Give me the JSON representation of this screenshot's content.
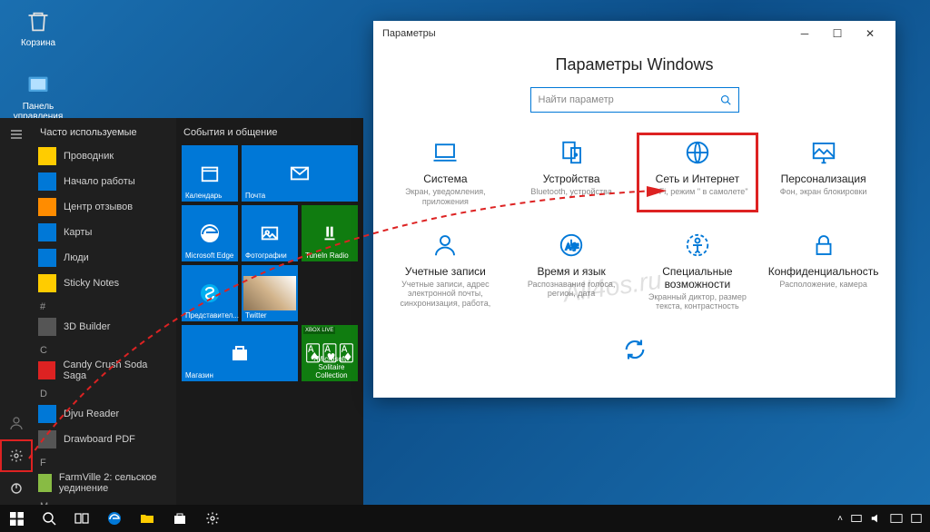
{
  "desktop": {
    "trash_label": "Корзина",
    "panel_label": "Панель управления"
  },
  "startmenu": {
    "freq_header": "Часто используемые",
    "apps_freq": [
      {
        "label": "Проводник",
        "color": "#ffcc00"
      },
      {
        "label": "Начало работы",
        "color": "#0078d7"
      },
      {
        "label": "Центр отзывов",
        "color": "#ff8c00"
      },
      {
        "label": "Карты",
        "color": "#0078d7"
      },
      {
        "label": "Люди",
        "color": "#0078d7"
      },
      {
        "label": "Sticky Notes",
        "color": "#ffcc00"
      }
    ],
    "sections": [
      {
        "letter": "#",
        "items": [
          {
            "label": "3D Builder",
            "color": "#555"
          }
        ]
      },
      {
        "letter": "C",
        "items": [
          {
            "label": "Candy Crush Soda Saga",
            "color": "#d22"
          }
        ]
      },
      {
        "letter": "D",
        "items": [
          {
            "label": "Djvu Reader",
            "color": "#0078d7"
          },
          {
            "label": "Drawboard PDF",
            "color": "#555"
          }
        ]
      },
      {
        "letter": "F",
        "items": [
          {
            "label": "FarmVille 2: сельское уединение",
            "color": "#8b4"
          }
        ]
      },
      {
        "letter": "M",
        "items": []
      }
    ],
    "tiles_header": "События и общение",
    "tiles_row1": [
      {
        "label": "Календарь"
      },
      {
        "label": "Почта",
        "wide": true
      }
    ],
    "tiles_row2": [
      {
        "label": "Microsoft Edge"
      },
      {
        "label": "Фотографии"
      },
      {
        "label": "TuneIn Radio",
        "green": true
      }
    ],
    "tiles_row3": [
      {
        "label": "Представител..."
      },
      {
        "label": "Twitter",
        "img": true
      }
    ],
    "tiles_row4": [
      {
        "label": "Магазин",
        "wide": true
      },
      {
        "label": "Microsoft Solitaire Collection",
        "green": true,
        "xbox": "XBOX LIVE"
      }
    ]
  },
  "settings": {
    "window_title": "Параметры",
    "heading": "Параметры Windows",
    "search_placeholder": "Найти параметр",
    "categories": [
      {
        "title": "Система",
        "desc": "Экран, уведомления, приложения",
        "icon": "laptop"
      },
      {
        "title": "Устройства",
        "desc": "Bluetooth, устройства",
        "icon": "devices"
      },
      {
        "title": "Сеть и Интернет",
        "desc": "Wi-Fi, режим \" в самолете\"",
        "icon": "globe",
        "highlight": true
      },
      {
        "title": "Персонализация",
        "desc": "Фон, экран блокировки",
        "icon": "personalize"
      },
      {
        "title": "Учетные записи",
        "desc": "Учетные записи, адрес электронной почты, синхронизация, работа,",
        "icon": "accounts"
      },
      {
        "title": "Время и язык",
        "desc": "Распознавание голоса, регион, дата",
        "icon": "time"
      },
      {
        "title": "Специальные возможности",
        "desc": "Экранный диктор, размер текста, контрастность",
        "icon": "ease"
      },
      {
        "title": "Конфиденциальность",
        "desc": "Расположение, камера",
        "icon": "privacy"
      }
    ],
    "update_icon": "update"
  },
  "watermark": "All4os.ru"
}
